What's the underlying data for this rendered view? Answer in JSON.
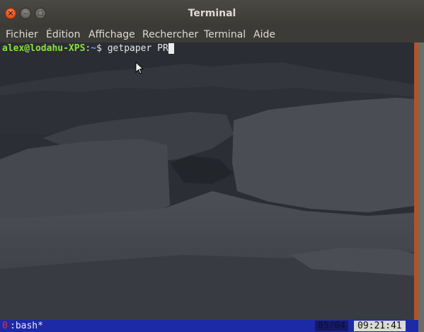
{
  "window": {
    "title": "Terminal"
  },
  "menu": [
    "Fichier",
    "Édition",
    "Affichage",
    "Rechercher",
    "Terminal",
    "Aide"
  ],
  "terminal": {
    "prompt_user": "alex@lodahu-XPS",
    "prompt_sep": ":",
    "prompt_path": "~",
    "prompt_symbol": "$ ",
    "command": "getpaper PR"
  },
  "tmux": {
    "window_index": "0",
    "window_name": ":bash*",
    "date": "05/04",
    "time": "09:21:41"
  },
  "colors": {
    "prompt_user": "#8ae234",
    "prompt_path": "#729fcf",
    "status_bg": "#1c2aa8",
    "window_index": "#e83030"
  }
}
